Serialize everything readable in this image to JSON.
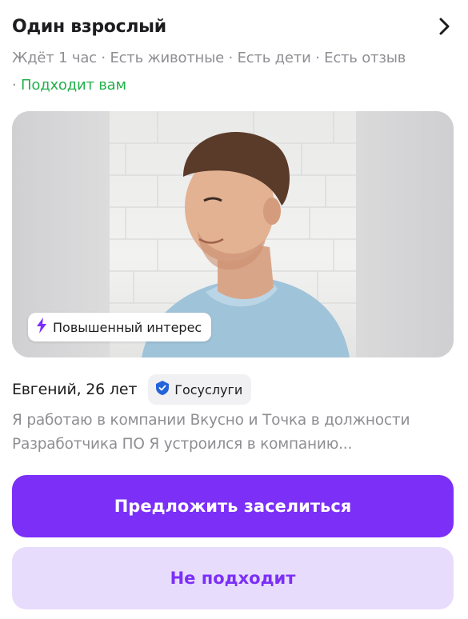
{
  "header": {
    "title": "Один взрослый"
  },
  "meta": {
    "tags": [
      "Ждёт 1 час",
      "Есть животные",
      "Есть дети",
      "Есть отзыв"
    ],
    "separator": " · ",
    "leading_separator": "· ",
    "fit_label": "Подходит вам"
  },
  "photo": {
    "badge_label": "Повышенный интерес",
    "badge_icon": "lightning-icon"
  },
  "person": {
    "name_age": "Евгений, 26 лет",
    "verification_label": "Госуслуги",
    "verification_icon": "verified-shield-icon"
  },
  "description": "Я работаю в компании Вкусно и Точка в должности Разработчика ПО Я устроился в компанию...",
  "actions": {
    "primary_label": "Предложить заселиться",
    "secondary_label": "Не подходит"
  },
  "colors": {
    "accent": "#7b2ff7",
    "accent_light": "#e8dcfd",
    "fit_green": "#22b04b",
    "muted_text": "#8e8e93",
    "gosuslugi_blue": "#2563d9"
  }
}
